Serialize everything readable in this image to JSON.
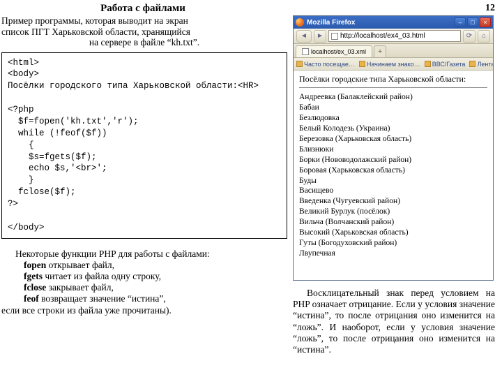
{
  "page_number": "12",
  "title": "Работа с файлами",
  "intro": {
    "l1": "Пример программы, которая выводит на экран",
    "l2": "список ПГТ Харьковской области, хранящийся",
    "l3": "на сервере в файле “kh.txt”."
  },
  "code": "<html>\n<body>\nПосёлки городского типа Харьковской области:<HR>\n\n<?php\n  $f=fopen('kh.txt','r');\n  while (!feof($f))\n    {\n    $s=fgets($f);\n    echo $s,'<br>';\n    }\n  fclose($f);\n?>\n\n</body>",
  "functions": {
    "lead": "Некоторые функции PHP для работы с файлами:",
    "items": [
      {
        "b": "fopen",
        "t": " открывает файл,"
      },
      {
        "b": "fgets",
        "t": " читает из файла одну строку,"
      },
      {
        "b": "fclose",
        "t": " закрывает файл,"
      }
    ],
    "feof_b": "feof",
    "feof_t1": " возвращает значение “истина”,",
    "feof_t2": "если все строки из файла уже прочитаны)."
  },
  "browser": {
    "title": "Mozilla Firefox",
    "url": "http://localhost/ex4_03.html",
    "tab": "localhost/ex_03.xml",
    "new_tab_glyph": "+",
    "bookmarks": [
      "Часто посещае…",
      "Начинаем знако…",
      "ВВС/Газета",
      "Лента новостей от Газ…"
    ],
    "heading": "Посёлки городские типа Харьковской области:",
    "list": [
      "Андреевка (Балаклейский район)",
      "Бабаи",
      "Безлюдовка",
      "Белый Колодезь (Украина)",
      "Березовка (Харьковская область)",
      "Близнюки",
      "Борки (Нововодолажский район)",
      "Боровая (Харьковская область)",
      "Буды",
      "Васищево",
      "Введенка (Чугуевский район)",
      "Великий Бурлук (посёлок)",
      "Вильча (Волчанский район)",
      "Высокий (Харьковская область)",
      "Гуты (Богодуховский район)",
      "Лвупечная"
    ]
  },
  "explain": "Восклицательный знак перед условием на PHP означает отрицание. Если у условия значение “истина”, то после отрицания оно изменится на “ложь”. И наоборот, если у условия значение “ложь”, то после отрицания оно изменится на “истина”."
}
